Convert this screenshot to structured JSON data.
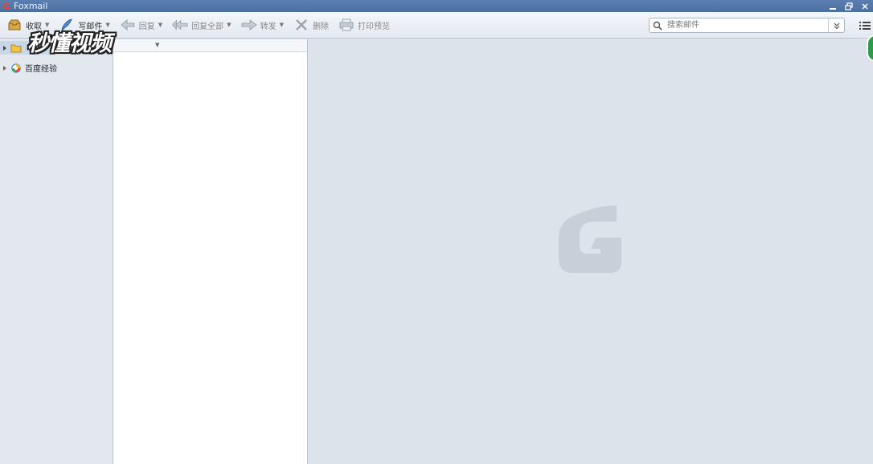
{
  "window": {
    "title": "Foxmail"
  },
  "toolbar": {
    "receive_label": "收取",
    "compose_label": "写邮件",
    "reply_label": "回复",
    "reply_all_label": "回复全部",
    "forward_label": "转发",
    "delete_label": "删除",
    "print_preview_label": "打印预览"
  },
  "search": {
    "placeholder": "搜索邮件"
  },
  "folders": {
    "items": [
      {
        "label": ""
      },
      {
        "label": "百度经验"
      }
    ]
  },
  "overlay": {
    "watermark_text": "秒懂视频"
  },
  "colors": {
    "titlebar": "#4a6fa0",
    "toolbar": "#e9eef4",
    "folder_pane": "#e2e8ee",
    "preview_pane": "#dce3ea",
    "logo_watermark": "#c7cfd8"
  },
  "icons": {
    "app": "foxmail-logo-icon",
    "receive": "inbox-tray-icon",
    "compose": "quill-pen-icon",
    "reply": "reply-arrow-icon",
    "reply_all": "reply-all-arrow-icon",
    "forward": "forward-arrow-icon",
    "delete": "delete-x-icon",
    "print": "printer-icon",
    "search": "magnifier-icon",
    "menu": "list-menu-icon"
  }
}
